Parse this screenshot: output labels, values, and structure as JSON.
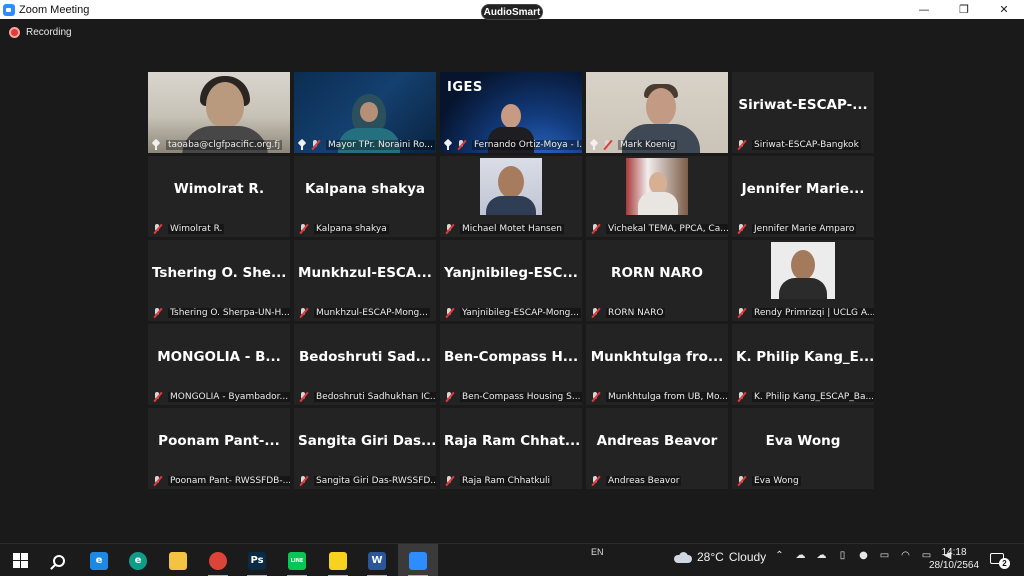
{
  "window": {
    "title": "Zoom Meeting",
    "minimize": "—",
    "maximize": "❐",
    "close": "✕",
    "overlay_badge": "AudioSmart"
  },
  "recording": {
    "label": "Recording"
  },
  "colors": {
    "active_speaker_border": "#c9e265",
    "muted_mic": "#e23b3b",
    "background": "#1a1a1a"
  },
  "participants": [
    {
      "label": "taoaba@clgfpacific.org.fj",
      "big_name": "",
      "video": true,
      "pinned": true,
      "muted": false,
      "active": true
    },
    {
      "label": "Mayor TPr. Noraini Ro...",
      "big_name": "",
      "video": true,
      "pinned": true,
      "muted": true,
      "active": false
    },
    {
      "label": "Fernando Ortiz-Moya - I...",
      "big_name": "",
      "video": true,
      "pinned": true,
      "muted": true,
      "active": false,
      "logo_text": "IGES"
    },
    {
      "label": "Mark Koenig",
      "big_name": "",
      "video": true,
      "pinned": true,
      "muted": true,
      "active": false
    },
    {
      "label": "Siriwat-ESCAP-Bangkok",
      "big_name": "Siriwat-ESCAP-...",
      "video": false,
      "pinned": false,
      "muted": true,
      "active": false
    },
    {
      "label": "Wimolrat R.",
      "big_name": "Wimolrat R.",
      "video": false,
      "pinned": false,
      "muted": true,
      "active": false
    },
    {
      "label": "Kalpana shakya",
      "big_name": "Kalpana shakya",
      "video": false,
      "pinned": false,
      "muted": true,
      "active": false
    },
    {
      "label": "Michael Motet Hansen",
      "big_name": "",
      "video": false,
      "photo": "michael",
      "pinned": false,
      "muted": true,
      "active": false
    },
    {
      "label": "Vichekal TEMA, PPCA, Ca...",
      "big_name": "",
      "video": false,
      "photo": "vichekal",
      "pinned": false,
      "muted": true,
      "active": false
    },
    {
      "label": "Jennifer Marie Amparo",
      "big_name": "Jennifer  Marie...",
      "video": false,
      "pinned": false,
      "muted": true,
      "active": false
    },
    {
      "label": "Tshering O. Sherpa-UN-H...",
      "big_name": "Tshering O. She...",
      "video": false,
      "pinned": false,
      "muted": true,
      "active": false
    },
    {
      "label": "Munkhzul-ESCAP-Mong...",
      "big_name": "Munkhzul-ESCA...",
      "video": false,
      "pinned": false,
      "muted": true,
      "active": false
    },
    {
      "label": "Yanjnibileg-ESCAP-Mong...",
      "big_name": "Yanjnibileg-ESC...",
      "video": false,
      "pinned": false,
      "muted": true,
      "active": false
    },
    {
      "label": "RORN NARO",
      "big_name": "RORN NARO",
      "video": false,
      "pinned": false,
      "muted": true,
      "active": false
    },
    {
      "label": "Rendy Primrizqi | UCLG A...",
      "big_name": "",
      "video": false,
      "photo": "rendy",
      "pinned": false,
      "muted": true,
      "active": false
    },
    {
      "label": "MONGOLIA - Byambador...",
      "big_name": "MONGOLIA  -  B...",
      "video": false,
      "pinned": false,
      "muted": true,
      "active": false
    },
    {
      "label": "Bedoshruti Sadhukhan IC...",
      "big_name": "Bedoshruti  Sad...",
      "video": false,
      "pinned": false,
      "muted": true,
      "active": false
    },
    {
      "label": "Ben-Compass Housing S...",
      "big_name": "Ben-Compass  H...",
      "video": false,
      "pinned": false,
      "muted": true,
      "active": false
    },
    {
      "label": "Munkhtulga from UB, Mo...",
      "big_name": "Munkhtulga  fro...",
      "video": false,
      "pinned": false,
      "muted": true,
      "active": false
    },
    {
      "label": "K. Philip Kang_ESCAP_Ba...",
      "big_name": "K. Philip Kang_E...",
      "video": false,
      "pinned": false,
      "muted": true,
      "active": false
    },
    {
      "label": "Poonam Pant- RWSSFDB-...",
      "big_name": "Poonam  Pant-...",
      "video": false,
      "pinned": false,
      "muted": true,
      "active": false
    },
    {
      "label": "Sangita Giri Das-RWSSFD...",
      "big_name": "Sangita Giri Das...",
      "video": false,
      "pinned": false,
      "muted": true,
      "active": false
    },
    {
      "label": "Raja Ram Chhatkuli",
      "big_name": "Raja Ram Chhat...",
      "video": false,
      "pinned": false,
      "muted": true,
      "active": false
    },
    {
      "label": "Andreas Beavor",
      "big_name": "Andreas Beavor",
      "video": false,
      "pinned": false,
      "muted": true,
      "active": false
    },
    {
      "label": "Eva Wong",
      "big_name": "Eva Wong",
      "video": false,
      "pinned": false,
      "muted": true,
      "active": false
    }
  ],
  "taskbar": {
    "apps": [
      {
        "name": "windows-start-icon",
        "glyph": ""
      },
      {
        "name": "search-icon",
        "glyph": ""
      },
      {
        "name": "internet-explorer-icon",
        "glyph": "e",
        "color": "#1e88e5"
      },
      {
        "name": "edge-icon",
        "glyph": "e",
        "color": "#0f9d8a"
      },
      {
        "name": "file-explorer-icon",
        "glyph": "",
        "color": "#f4c342"
      },
      {
        "name": "chrome-icon",
        "glyph": "",
        "color": "#db4437"
      },
      {
        "name": "photoshop-icon",
        "glyph": "Ps",
        "color": "#0b2b45"
      },
      {
        "name": "line-app-icon",
        "glyph": "LINE",
        "color": "#06c755"
      },
      {
        "name": "sticky-notes-icon",
        "glyph": "",
        "color": "#f7d31e"
      },
      {
        "name": "word-icon",
        "glyph": "W",
        "color": "#2b579a"
      },
      {
        "name": "zoom-icon",
        "glyph": "",
        "color": "#2d8cff"
      }
    ],
    "language": "EN",
    "weather": {
      "temp": "28°C",
      "condition": "Cloudy"
    },
    "tray": [
      {
        "name": "show-hidden-icons-icon",
        "glyph": "⌃"
      },
      {
        "name": "onedrive-icon",
        "glyph": "☁"
      },
      {
        "name": "cloud-sync-icon",
        "glyph": "☁"
      },
      {
        "name": "usb-icon",
        "glyph": "▯"
      },
      {
        "name": "microphone-icon",
        "glyph": "●"
      },
      {
        "name": "display-icon",
        "glyph": "▭"
      },
      {
        "name": "wifi-icon",
        "glyph": "◠"
      },
      {
        "name": "battery-icon",
        "glyph": "▭"
      },
      {
        "name": "volume-icon",
        "glyph": "◀"
      }
    ],
    "clock": {
      "time": "14:18",
      "date": "28/10/2564"
    },
    "notifications": {
      "count": "2"
    }
  }
}
